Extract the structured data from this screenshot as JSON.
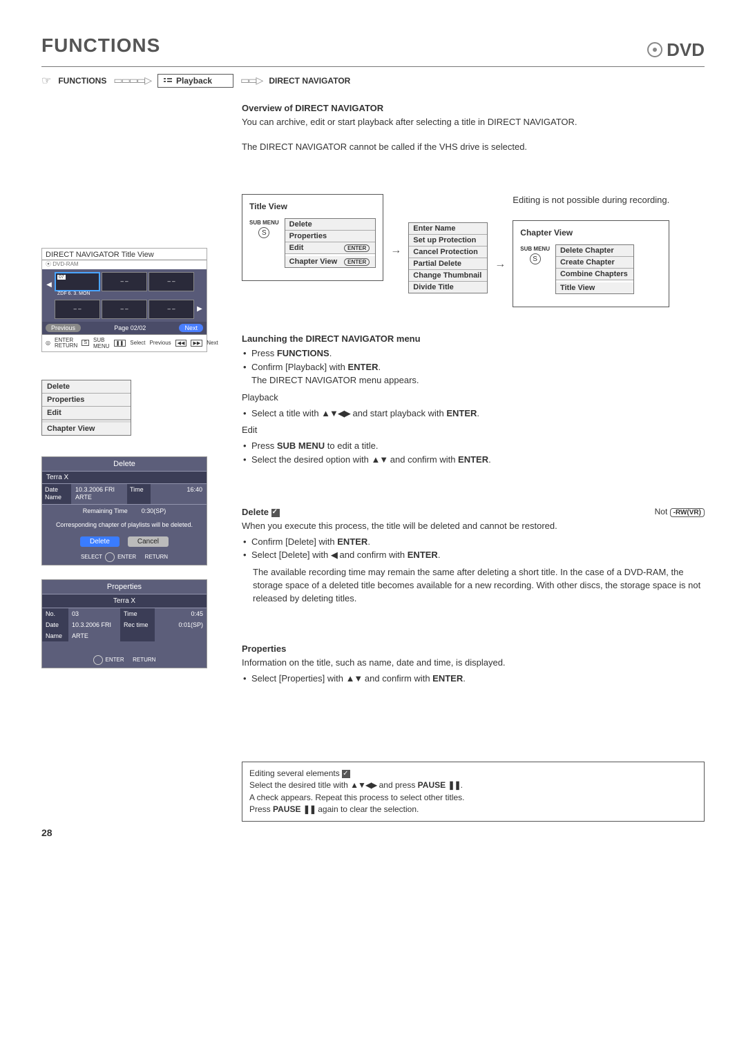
{
  "header": {
    "title": "FUNCTIONS",
    "dvd": "DVD"
  },
  "breadcrumb": {
    "functions": "FUNCTIONS",
    "playback": "Playback",
    "direct_nav": "DIRECT NAVIGATOR"
  },
  "overview": {
    "heading": "Overview of DIRECT NAVIGATOR",
    "p1": "You can archive, edit or start playback after selecting a title in DIRECT NAVIGATOR.",
    "p2": "The DIRECT NAVIGATOR cannot be called if the VHS drive is selected."
  },
  "nav_screen": {
    "title": "DIRECT NAVIGATOR  Title View",
    "sub": "DVD-RAM",
    "cells": {
      "c1_rec": "07",
      "c1_sub": "ZDF  6. 3. MON",
      "c2": "– –",
      "c3": "– –",
      "c4": "– –",
      "c5": "– –",
      "c6": "– –"
    },
    "footer": {
      "prev": "Previous",
      "page": "Page 02/02",
      "next": "Next"
    },
    "bottom": {
      "enter": "ENTER",
      "return": "RETURN",
      "submenu": "SUB MENU",
      "select": "Select",
      "prevlbl": "Previous",
      "nextlbl": "Next",
      "s": "S",
      "pause": "❚❚",
      "rew": "◀◀",
      "ff": "▶▶"
    }
  },
  "diagram": {
    "title_view": "Title View",
    "sub_menu": "SUB MENU",
    "s": "S",
    "menu1": {
      "delete": "Delete",
      "properties": "Properties",
      "edit": "Edit",
      "chapter_view": "Chapter View",
      "enter": "ENTER"
    },
    "menu2": {
      "enter_name": "Enter Name",
      "set_up_protection": "Set up Protection",
      "cancel_protection": "Cancel Protection",
      "partial_delete": "Partial Delete",
      "change_thumbnail": "Change Thumbnail",
      "divide_title": "Divide Title"
    },
    "note": "Editing is not possible during recording.",
    "chapter_view": "Chapter View",
    "menu3": {
      "delete_chapter": "Delete Chapter",
      "create_chapter": "Create Chapter",
      "combine_chapters": "Combine Chapters",
      "title_view": "Title View"
    }
  },
  "launch": {
    "heading": "Launching the DIRECT NAVIGATOR menu",
    "b1a": "Press ",
    "b1b": "FUNCTIONS",
    "b1c": ".",
    "b2a": "Confirm [Playback] with ",
    "b2b": "ENTER",
    "b2c": ".",
    "b2_sub": "The DIRECT NAVIGATOR menu appears.",
    "playback_h": "Playback",
    "pb1a": "Select a title with ",
    "pb1b": "▲▼◀▶",
    "pb1c": " and start playback with ",
    "pb1d": "ENTER",
    "pb1e": ".",
    "edit_h": "Edit",
    "e1a": "Press ",
    "e1b": "SUB MENU",
    "e1c": " to edit a title.",
    "e2a": "Select the desired option with ",
    "e2b": "▲▼",
    "e2c": " and confirm with ",
    "e2d": "ENTER",
    "e2e": "."
  },
  "small_menu": {
    "delete": "Delete",
    "properties": "Properties",
    "edit": "Edit",
    "chapter_view": "Chapter View"
  },
  "delete_dialog": {
    "title": "Delete",
    "name": "Terra X",
    "date_lbl": "Date",
    "name_lbl": "Name",
    "date_val": "10.3.2006 FRI",
    "name_val": "ARTE",
    "time_lbl": "Time",
    "time_val": "16:40",
    "remaining_lbl": "Remaining Time",
    "remaining_val": "0:30(SP)",
    "msg": "Corresponding chapter of playlists will be deleted.",
    "btn_delete": "Delete",
    "btn_cancel": "Cancel",
    "foot_select": "SELECT",
    "foot_enter": "ENTER",
    "foot_return": "RETURN"
  },
  "delete_section": {
    "heading": "Delete ",
    "not": "Not ",
    "badge": "-RW(VR)",
    "p1": "When you execute this process, the title will be deleted and cannot be restored.",
    "b1a": "Confirm [Delete] with ",
    "b1b": "ENTER",
    "b1c": ".",
    "b2a": "Select [Delete] with ",
    "b2b": "◀",
    "b2c": " and confirm with ",
    "b2d": "ENTER",
    "b2e": ".",
    "note": "The available recording time may remain the same after deleting a short title. In the case of a DVD-RAM, the storage space of a deleted title becomes available for a new recording. With other discs, the storage space is not released by deleting titles."
  },
  "properties_dialog": {
    "title": "Properties",
    "name": "Terra X",
    "no_lbl": "No.",
    "no_val": "03",
    "date_lbl": "Date",
    "date_val": "10.3.2006 FRI",
    "name_lbl": "Name",
    "name_val": "ARTE",
    "time_lbl": "Time",
    "time_val": "0:45",
    "rec_lbl": "Rec time",
    "rec_val": "0:01(SP)",
    "foot_enter": "ENTER",
    "foot_return": "RETURN"
  },
  "properties_section": {
    "heading": "Properties",
    "p1": "Information on the title, such as name, date and time, is displayed.",
    "b1a": "Select [Properties] with ",
    "b1b": "▲▼",
    "b1c": " and confirm with ",
    "b1d": "ENTER",
    "b1e": "."
  },
  "info_box": {
    "l1a": "Editing several elements ",
    "l2a": "Select the desired title with ",
    "l2b": "▲▼◀▶",
    "l2c": " and press ",
    "l2d": "PAUSE ",
    "l2e": ".",
    "l3": "A check appears. Repeat this process to select other titles.",
    "l4a": "Press ",
    "l4b": "PAUSE ",
    "l4c": " again to clear the selection."
  },
  "page_number": "28"
}
